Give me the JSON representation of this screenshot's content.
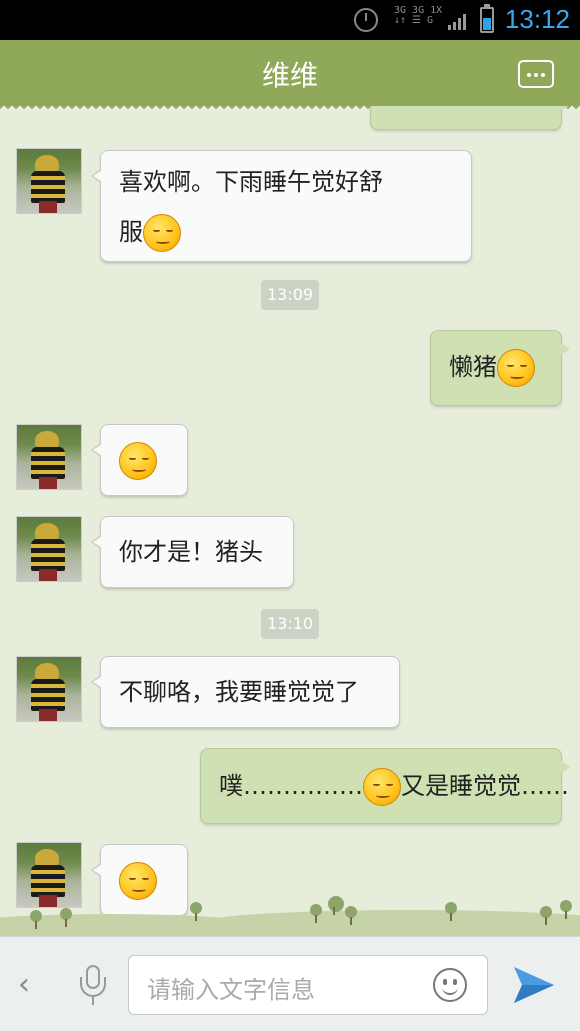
{
  "status_bar": {
    "time": "13:12",
    "network_top": "3G 3G 1X",
    "network_bottom": "↓↑  ☰  G"
  },
  "header": {
    "title": "维维",
    "menu_icon": "more-dots-icon"
  },
  "messages": [
    {
      "side": "in",
      "text": "喜欢啊。下雨睡午觉好舒",
      "text2": "服",
      "emoji": "smile-emoji"
    },
    {
      "type": "time",
      "text": "13:09"
    },
    {
      "side": "out",
      "text": "懒猪",
      "emoji": "yawn-emoji"
    },
    {
      "side": "in",
      "emoji": "content-emoji"
    },
    {
      "side": "in",
      "text": "你才是！猪头"
    },
    {
      "type": "time",
      "text": "13:10"
    },
    {
      "side": "in",
      "text": "不聊咯，我要睡觉觉了"
    },
    {
      "side": "out",
      "text": "噗……………",
      "emoji": "yawn-emoji",
      "text2": "又是睡觉觉……"
    },
    {
      "side": "in",
      "emoji": "content-emoji"
    }
  ],
  "input_bar": {
    "placeholder": "请输入文字信息",
    "back_icon": "‹",
    "voice_icon": "microphone-icon",
    "emoji_icon": "smiley-icon",
    "send_icon": "send-icon"
  },
  "colors": {
    "header": "#8fa85a",
    "chat_bg": "#e6edda",
    "out_bubble": "#cfe0b2",
    "in_bubble": "#fafafa",
    "clock": "#3aa9ec"
  }
}
